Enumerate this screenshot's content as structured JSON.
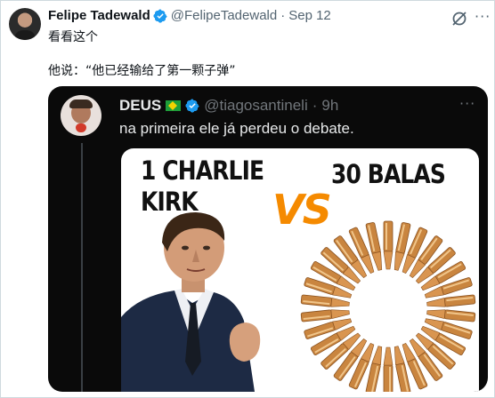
{
  "tweet": {
    "author_name": "Felipe Tadewald",
    "handle": "@FelipeTadewald",
    "separator": "·",
    "date": "Sep 12",
    "line1": "看看这个",
    "line2": "他说：“他已经输给了第一颗子弹”"
  },
  "quoted": {
    "author_name": "DEUS",
    "handle": "@tiagosantineli",
    "separator": "·",
    "time": "9h",
    "text": "na primeira ele já perdeu o debate.",
    "image": {
      "left_line1": "1 CHARLIE",
      "left_line2": "KIRK",
      "versus": "VS",
      "right_text": "30 BALAS"
    }
  },
  "colors": {
    "verified_blue": "#1d9bf0",
    "vs_orange": "#f58a00",
    "quote_bg": "#0a0a0a"
  },
  "icons": [
    "verified-badge-icon",
    "grok-icon",
    "more-options-icon",
    "brazil-flag-icon"
  ]
}
